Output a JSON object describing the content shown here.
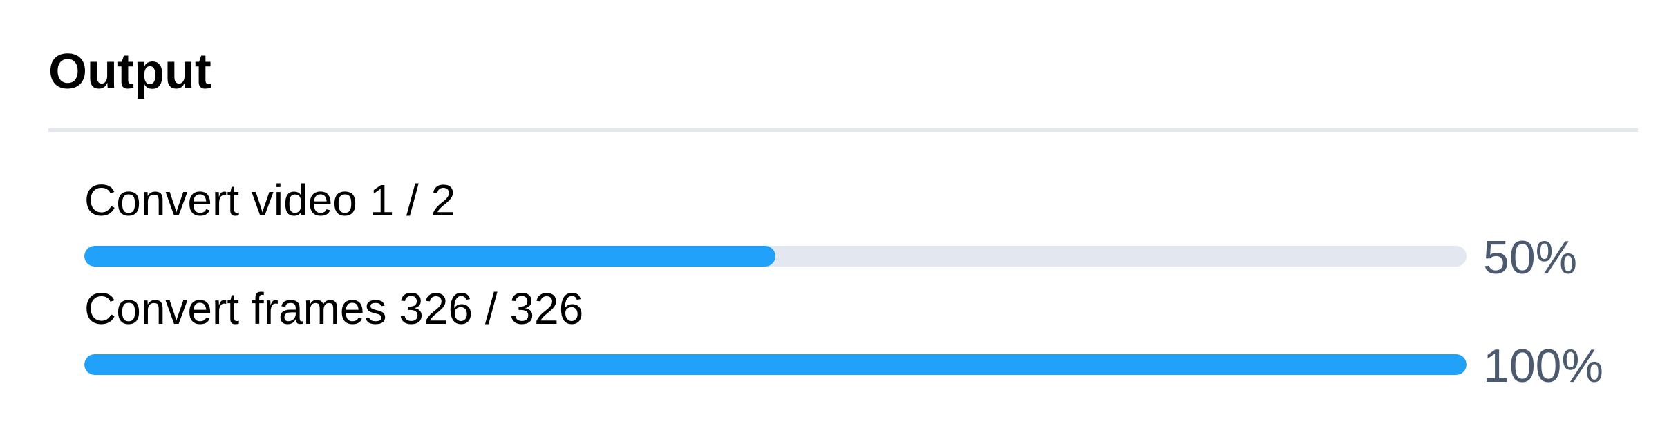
{
  "panel": {
    "title": "Output"
  },
  "tasks": [
    {
      "label": "Convert video 1 / 2",
      "progress": 0.5,
      "percent_text": "50%"
    },
    {
      "label": "Convert frames 326 / 326",
      "progress": 1.0,
      "percent_text": "100%"
    }
  ],
  "colors": {
    "accent": "#22a1fb",
    "track": "#e3e7ef",
    "divider": "#e5e7ee",
    "percent_text": "#4c5a70"
  }
}
